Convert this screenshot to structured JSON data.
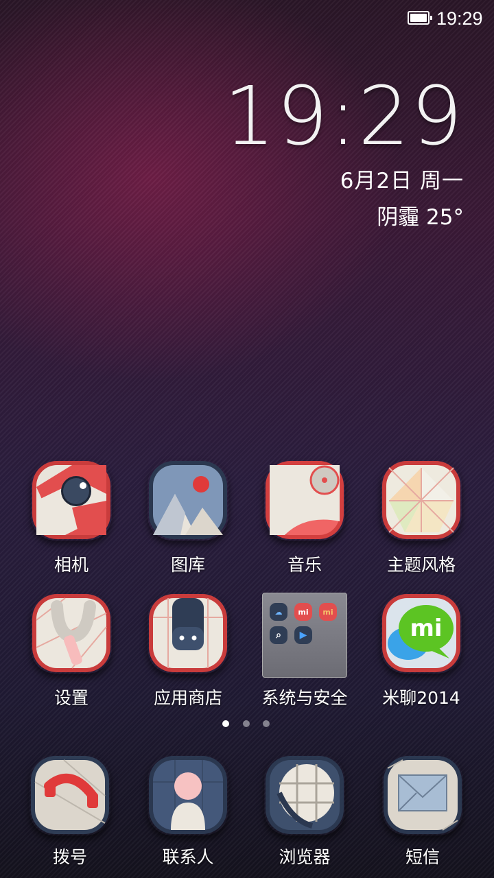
{
  "status_bar": {
    "time": "19:29",
    "battery_level": 1.0
  },
  "clock_widget": {
    "time": "19:29",
    "date": "6月2日 周一",
    "weather": "阴霾  25°"
  },
  "grid_row1": [
    {
      "label": "相机",
      "icon": "camera-icon"
    },
    {
      "label": "图库",
      "icon": "gallery-icon"
    },
    {
      "label": "音乐",
      "icon": "music-icon"
    },
    {
      "label": "主题风格",
      "icon": "theme-icon"
    }
  ],
  "grid_row2": [
    {
      "label": "设置",
      "icon": "settings-icon"
    },
    {
      "label": "应用商店",
      "icon": "app-store-icon"
    },
    {
      "label": "系统与安全",
      "icon": "folder-icon"
    },
    {
      "label": "米聊2014",
      "icon": "miliao-icon"
    }
  ],
  "folder_mini_icons": [
    "cloud-icon",
    "mi-account-icon",
    "mi-icon",
    "search-icon",
    "video-icon"
  ],
  "folder_mini_labels": {
    "mi1": "mi",
    "mi2": "mi"
  },
  "miliao_badge_text": "mi",
  "page_indicator": {
    "count": 3,
    "active": 0
  },
  "dock": [
    {
      "label": "拨号",
      "icon": "phone-icon"
    },
    {
      "label": "联系人",
      "icon": "contacts-icon"
    },
    {
      "label": "浏览器",
      "icon": "browser-icon"
    },
    {
      "label": "短信",
      "icon": "messages-icon"
    }
  ],
  "colors": {
    "accent_red": "#e14a4a",
    "icon_navy": "#2f3d55",
    "icon_cream": "#ece7de",
    "miliao_green": "#5cc423"
  }
}
